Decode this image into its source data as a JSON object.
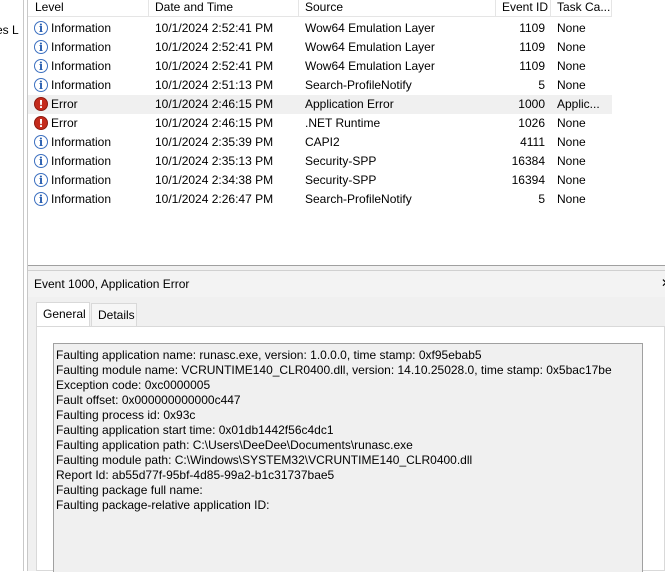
{
  "left_pane": {
    "cut_text": "es L"
  },
  "columns": {
    "level": "Level",
    "date": "Date and Time",
    "source": "Source",
    "event_id": "Event ID",
    "task": "Task Ca..."
  },
  "events": [
    {
      "icon": "info-icon",
      "level": "Information",
      "date": "10/1/2024 2:52:41 PM",
      "source": "Wow64 Emulation Layer",
      "event_id": "1109",
      "task": "None"
    },
    {
      "icon": "info-icon",
      "level": "Information",
      "date": "10/1/2024 2:52:41 PM",
      "source": "Wow64 Emulation Layer",
      "event_id": "1109",
      "task": "None"
    },
    {
      "icon": "info-icon",
      "level": "Information",
      "date": "10/1/2024 2:52:41 PM",
      "source": "Wow64 Emulation Layer",
      "event_id": "1109",
      "task": "None"
    },
    {
      "icon": "info-icon",
      "level": "Information",
      "date": "10/1/2024 2:51:13 PM",
      "source": "Search-ProfileNotify",
      "event_id": "5",
      "task": "None"
    },
    {
      "icon": "error-icon",
      "level": "Error",
      "date": "10/1/2024 2:46:15 PM",
      "source": "Application Error",
      "event_id": "1000",
      "task": "Applic...",
      "selected": true
    },
    {
      "icon": "error-icon",
      "level": "Error",
      "date": "10/1/2024 2:46:15 PM",
      "source": ".NET Runtime",
      "event_id": "1026",
      "task": "None"
    },
    {
      "icon": "info-icon",
      "level": "Information",
      "date": "10/1/2024 2:35:39 PM",
      "source": "CAPI2",
      "event_id": "4111",
      "task": "None"
    },
    {
      "icon": "info-icon",
      "level": "Information",
      "date": "10/1/2024 2:35:13 PM",
      "source": "Security-SPP",
      "event_id": "16384",
      "task": "None"
    },
    {
      "icon": "info-icon",
      "level": "Information",
      "date": "10/1/2024 2:34:38 PM",
      "source": "Security-SPP",
      "event_id": "16394",
      "task": "None"
    },
    {
      "icon": "info-icon",
      "level": "Information",
      "date": "10/1/2024 2:26:47 PM",
      "source": "Search-ProfileNotify",
      "event_id": "5",
      "task": "None"
    }
  ],
  "details": {
    "title": "Event 1000, Application Error",
    "tabs": [
      "General",
      "Details"
    ],
    "active_tab": "General",
    "description": [
      "Faulting application name: runasc.exe, version: 1.0.0.0, time stamp: 0xf95ebab5",
      "Faulting module name: VCRUNTIME140_CLR0400.dll, version: 14.10.25028.0, time stamp: 0x5bac17be",
      "Exception code: 0xc0000005",
      "Fault offset: 0x000000000000c447",
      "Faulting process id: 0x93c",
      "Faulting application start time: 0x01db1442f56c4dc1",
      "Faulting application path: C:\\Users\\DeeDee\\Documents\\runasc.exe",
      "Faulting module path: C:\\Windows\\SYSTEM32\\VCRUNTIME140_CLR0400.dll",
      "Report Id: ab55d77f-95bf-4d85-99a2-b1c31737bae5",
      "Faulting package full name: ",
      "Faulting package-relative application ID: "
    ]
  },
  "colors": {
    "error": "#c42b1c",
    "info": "#3c70c0",
    "selected_row": "#f0f0f0"
  }
}
